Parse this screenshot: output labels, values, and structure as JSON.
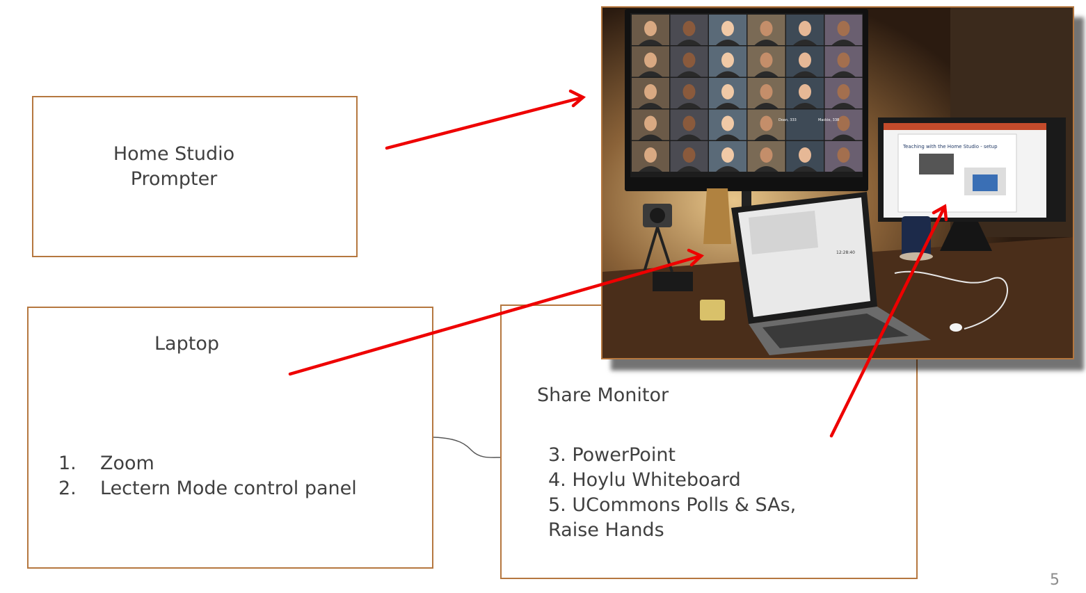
{
  "boxes": {
    "prompter": {
      "line1": "Home Studio",
      "line2": "Prompter"
    },
    "laptop": {
      "title": "Laptop",
      "items": [
        {
          "num": "1.",
          "text": "Zoom"
        },
        {
          "num": "2.",
          "text": "Lectern Mode control panel"
        }
      ]
    },
    "share_monitor": {
      "title": "Share Monitor",
      "items": [
        "3. PowerPoint",
        "4. Hoylu Whiteboard",
        "5. UCommons Polls & SAs,",
        "Raise Hands"
      ]
    }
  },
  "photo": {
    "zoom_tiles": [
      "Doan, 333",
      "Mackie, 338"
    ],
    "slide_title": "Teaching with the Home Studio - setup",
    "laptop_clock": "12:28:40"
  },
  "page_number": "5",
  "colors": {
    "box_border": "#b5773f",
    "arrow": "#ee0000",
    "text": "#404040"
  }
}
